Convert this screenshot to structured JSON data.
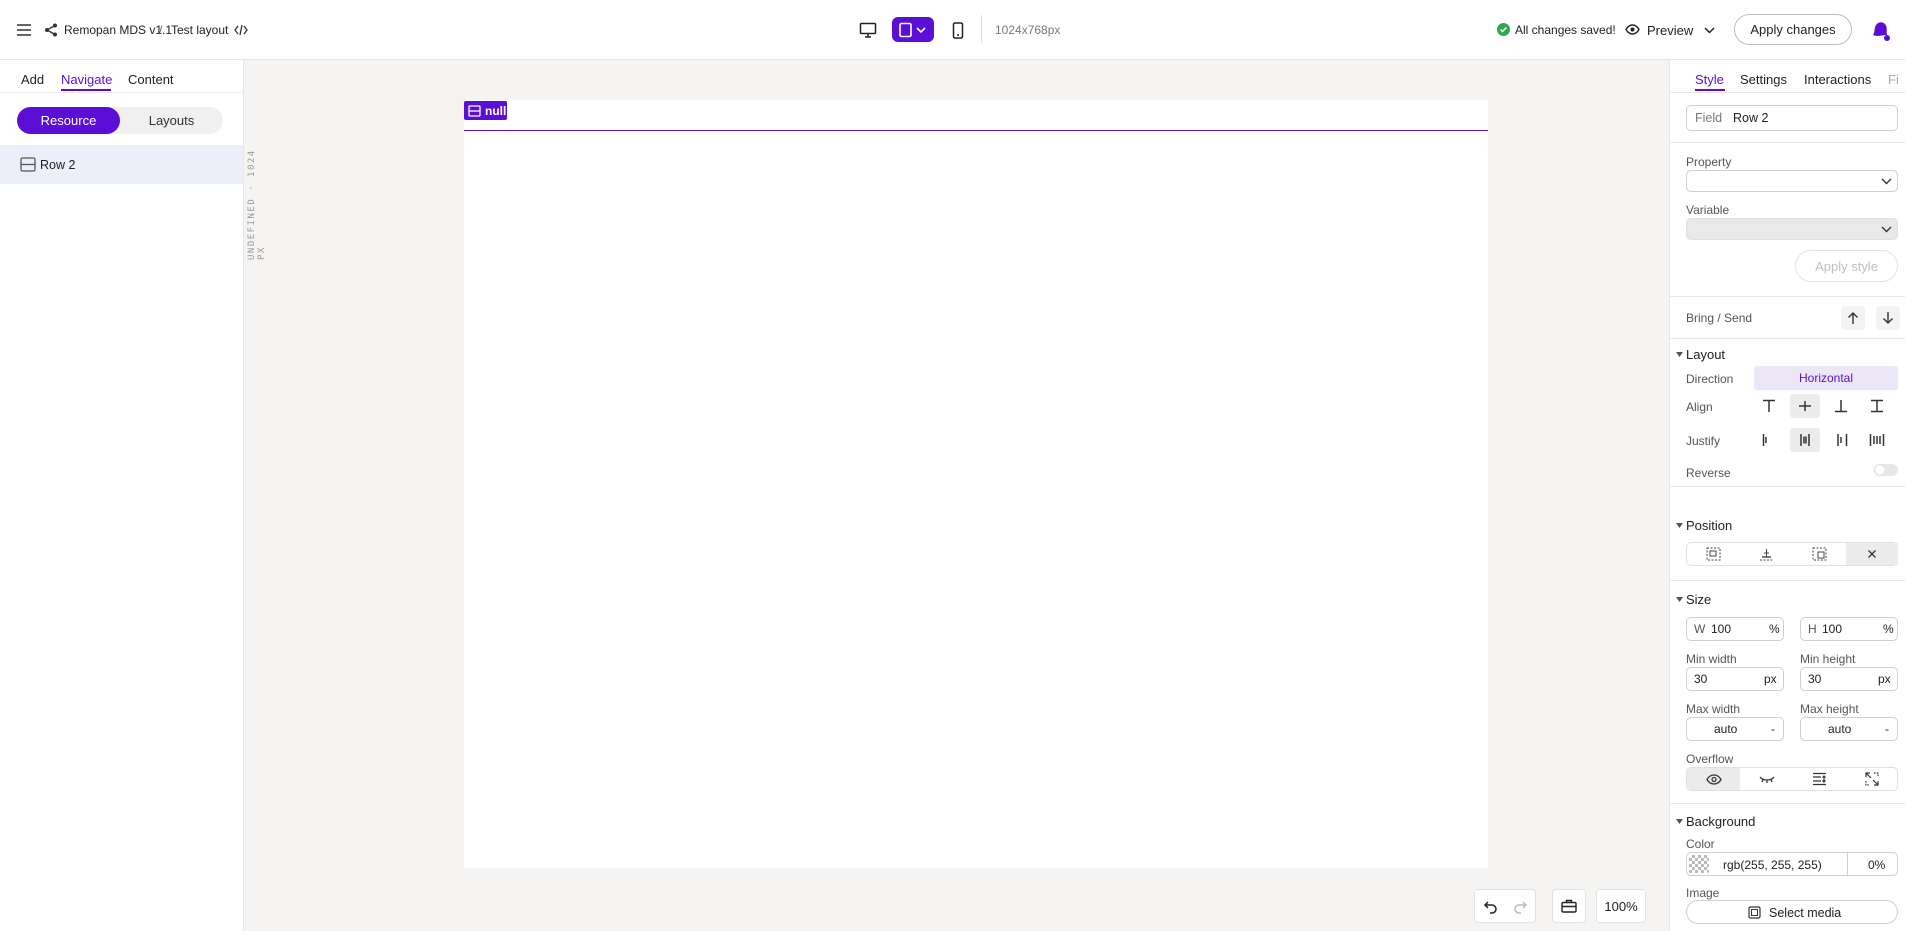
{
  "topbar": {
    "project": "Remopan MDS v1.1",
    "separator": "/",
    "layout_name": "Test layout",
    "resolution": "1024x768px",
    "status": "All changes saved!",
    "preview_label": "Preview",
    "apply_label": "Apply changes",
    "accent": "#5b0fd6"
  },
  "left_panel": {
    "tabs": [
      "Add",
      "Navigate",
      "Content"
    ],
    "active_tab": "Navigate",
    "toggle": [
      "Resource",
      "Layouts"
    ],
    "tree_items": [
      {
        "label": "Row 2",
        "icon": "row-icon"
      }
    ]
  },
  "canvas": {
    "ruler_label": "UNDEFINED · 1024 PX",
    "element_tag": "null",
    "zoom": "100%"
  },
  "right_panel": {
    "tabs": [
      "Style",
      "Settings",
      "Interactions",
      "Fi"
    ],
    "field_label": "Field",
    "field_value": "Row 2",
    "property_label": "Property",
    "variable_label": "Variable",
    "apply_style": "Apply style",
    "bring_send": "Bring / Send",
    "layout": {
      "title": "Layout",
      "direction_label": "Direction",
      "direction_value": "Horizontal",
      "align_label": "Align",
      "justify_label": "Justify",
      "reverse_label": "Reverse"
    },
    "position_title": "Position",
    "size": {
      "title": "Size",
      "w_label": "W",
      "w_value": "100",
      "w_unit": "%",
      "h_label": "H",
      "h_value": "100",
      "h_unit": "%",
      "min_width_label": "Min width",
      "min_width_value": "30",
      "min_width_unit": "px",
      "min_height_label": "Min height",
      "min_height_value": "30",
      "min_height_unit": "px",
      "max_width_label": "Max width",
      "max_width_value": "auto",
      "max_width_unit": "-",
      "max_height_label": "Max height",
      "max_height_value": "auto",
      "max_height_unit": "-",
      "overflow_label": "Overflow"
    },
    "background": {
      "title": "Background",
      "color_label": "Color",
      "color_value": "rgb(255, 255, 255)",
      "opacity": "0%",
      "image_label": "Image",
      "select_media": "Select media"
    }
  }
}
